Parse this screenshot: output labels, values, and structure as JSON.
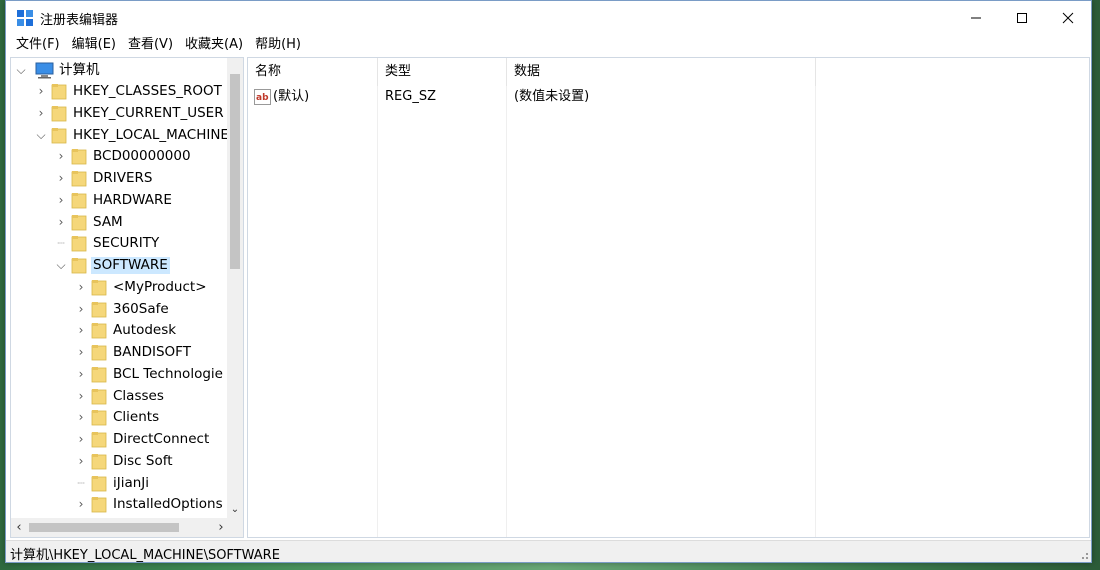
{
  "window": {
    "title": "注册表编辑器"
  },
  "menubar": [
    "文件(F)",
    "编辑(E)",
    "查看(V)",
    "收藏夹(A)",
    "帮助(H)"
  ],
  "tree": {
    "root_label": "计算机",
    "nodes": [
      {
        "label": "HKEY_CLASSES_ROOT",
        "expander": "collapsed"
      },
      {
        "label": "HKEY_CURRENT_USER",
        "expander": "collapsed"
      },
      {
        "label": "HKEY_LOCAL_MACHINE",
        "expander": "expanded"
      },
      {
        "label": "BCD00000000",
        "expander": "collapsed"
      },
      {
        "label": "DRIVERS",
        "expander": "collapsed"
      },
      {
        "label": "HARDWARE",
        "expander": "collapsed"
      },
      {
        "label": "SAM",
        "expander": "collapsed"
      },
      {
        "label": "SECURITY",
        "expander": "none"
      },
      {
        "label": "SOFTWARE",
        "expander": "expanded",
        "selected": true
      },
      {
        "label": "<MyProduct>",
        "expander": "collapsed"
      },
      {
        "label": "360Safe",
        "expander": "collapsed"
      },
      {
        "label": "Autodesk",
        "expander": "collapsed"
      },
      {
        "label": "BANDISOFT",
        "expander": "collapsed"
      },
      {
        "label": "BCL Technologie",
        "expander": "collapsed"
      },
      {
        "label": "Classes",
        "expander": "collapsed"
      },
      {
        "label": "Clients",
        "expander": "collapsed"
      },
      {
        "label": "DirectConnect",
        "expander": "collapsed"
      },
      {
        "label": "Disc Soft",
        "expander": "collapsed"
      },
      {
        "label": "iJianJi",
        "expander": "none"
      },
      {
        "label": "InstalledOptions",
        "expander": "collapsed"
      }
    ]
  },
  "list": {
    "columns": [
      "名称",
      "类型",
      "数据"
    ],
    "rows": [
      {
        "name": "(默认)",
        "type": "REG_SZ",
        "data": "(数值未设置)",
        "icon": "string-value-icon"
      }
    ]
  },
  "status": {
    "path": "计算机\\HKEY_LOCAL_MACHINE\\SOFTWARE"
  },
  "colors": {
    "selection": "#cce8ff",
    "folder": "#f5d77a",
    "accent": "#1e6fd9"
  }
}
